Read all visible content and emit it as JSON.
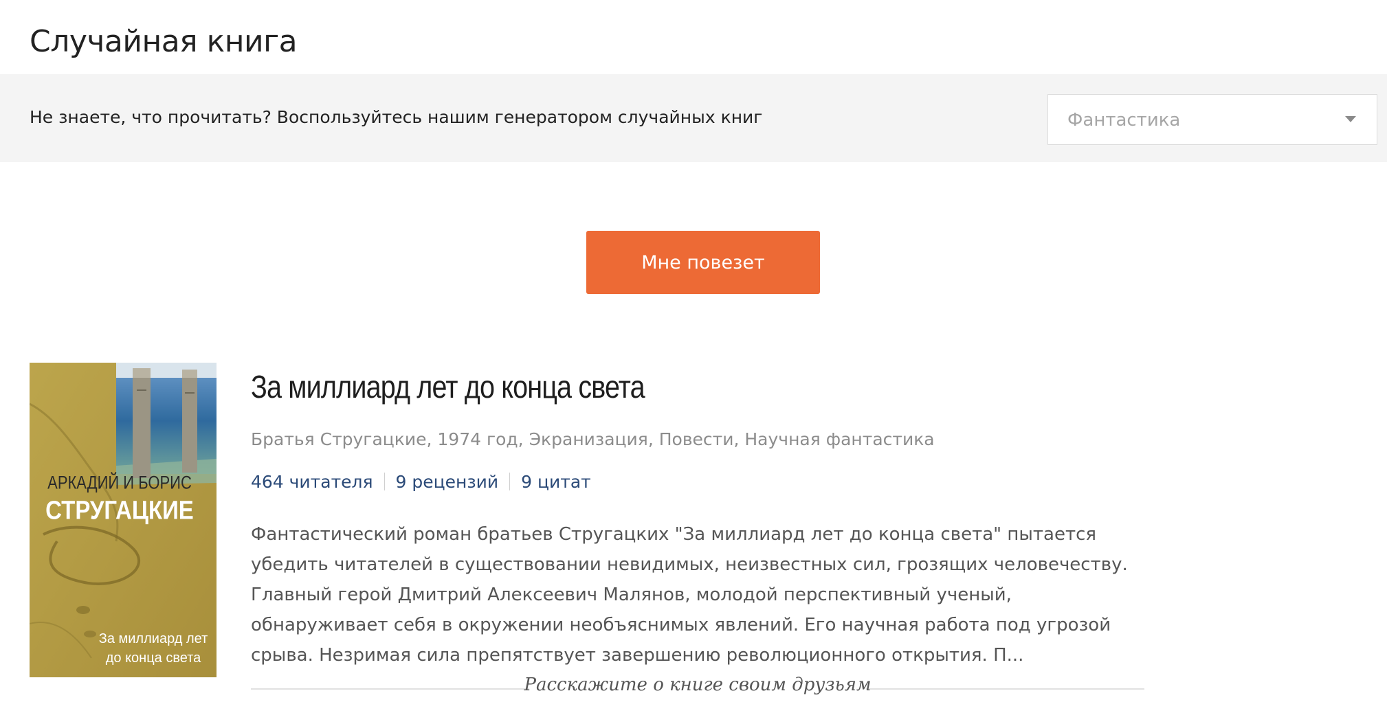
{
  "page": {
    "title": "Случайная книга"
  },
  "filter": {
    "prompt": "Не знаете, что прочитать? Воспользуйтесь нашим генератором случайных книг",
    "genre_selected": "Фантастика"
  },
  "lucky_button": {
    "label": "Мне повезет"
  },
  "book": {
    "title": "За миллиард лет до конца света",
    "meta": "Братья Стругацкие, 1974 год, Экранизация, Повести, Научная фантастика",
    "stats": {
      "readers": "464 читателя",
      "reviews": "9 рецензий",
      "quotes": "9 цитат"
    },
    "description": "Фантастический роман братьев Стругацких \"За миллиард лет до конца света\" пытается убедить читателей в существовании невидимых, неизвестных сил, грозящих человечеству. Главный герой Дмитрий Алексеевич Малянов, молодой перспективный ученый, обнаруживает себя в окружении необъяснимых явлений. Его научная работа под угрозой срыва. Незримая сила препятствует завершению революционного открытия. П...",
    "cover": {
      "author_line1": "АРКАДИЙ И БОРИС",
      "author_line2": "СТРУГАЦКИЕ",
      "title_line1": "За миллиард лет",
      "title_line2": "до конца света"
    }
  },
  "share": {
    "label": "Расскажите о книге своим друзьям"
  },
  "colors": {
    "accent": "#ed6a35",
    "link": "#2b4a78",
    "filter_bar_bg": "#f4f4f4",
    "meta_text": "#8c8c8c",
    "cover_sand": "#b59d45"
  }
}
